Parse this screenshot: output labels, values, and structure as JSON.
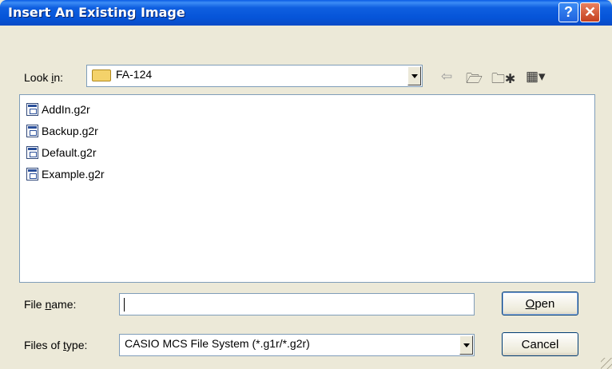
{
  "dialog": {
    "title": "Insert An Existing Image",
    "help_glyph": "?",
    "close_glyph": "✕"
  },
  "look_in": {
    "label_pre": "Look ",
    "label_u": "i",
    "label_post": "n:",
    "value": "FA-124",
    "icon": "folder-icon"
  },
  "toolbar": {
    "back_icon": "back-arrow-icon",
    "back_glyph": "⇦",
    "up_icon": "up-folder-icon",
    "up_glyph": "🗁",
    "new_folder_icon": "new-folder-icon",
    "new_folder_glyph": "🗀✱",
    "view_menu_icon": "view-menu-icon",
    "view_glyph": "▦▾"
  },
  "files": [
    {
      "name": "AddIn.g2r"
    },
    {
      "name": "Backup.g2r"
    },
    {
      "name": "Default.g2r"
    },
    {
      "name": "Example.g2r"
    }
  ],
  "file_name": {
    "label_pre": "File ",
    "label_u": "n",
    "label_post": "ame:",
    "value": ""
  },
  "file_type": {
    "label_pre": "Files of ",
    "label_u": "t",
    "label_post": "ype:",
    "value": "CASIO MCS File System (*.g1r/*.g2r)"
  },
  "buttons": {
    "open_u": "O",
    "open_rest": "pen",
    "cancel": "Cancel"
  }
}
